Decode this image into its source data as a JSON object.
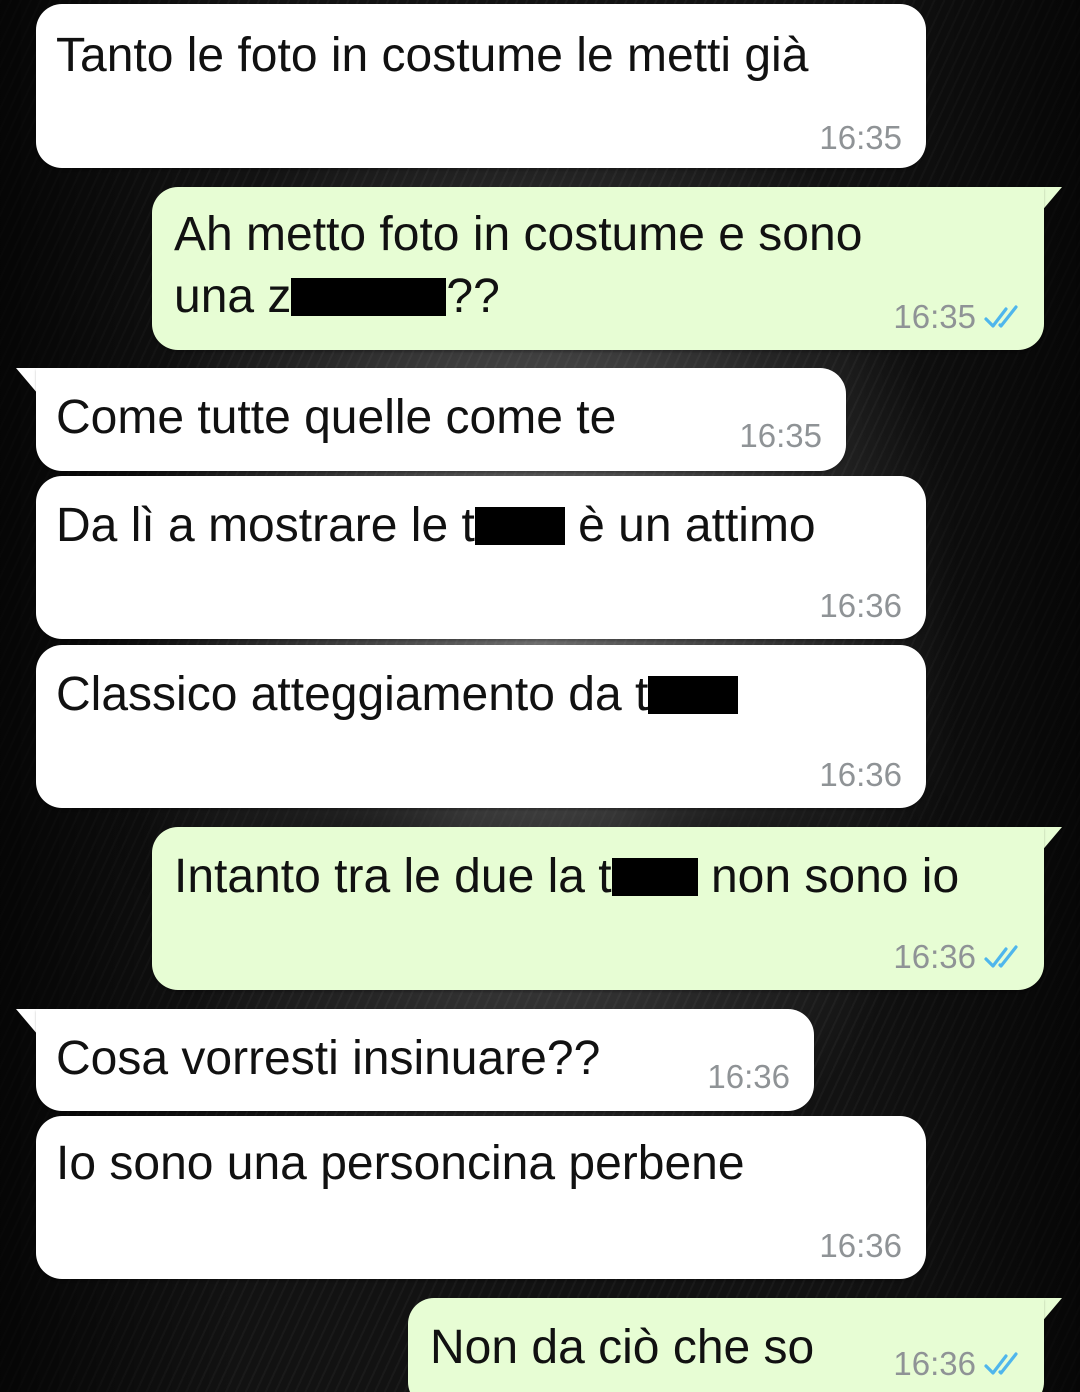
{
  "messages": [
    {
      "id": "m1",
      "direction": "incoming",
      "text": "Tanto le foto in costume le metti già",
      "time": "16:35"
    },
    {
      "id": "m2",
      "direction": "outgoing",
      "line1": "Ah metto foto in costume e sono",
      "line2_before": "una z",
      "line2_after": "??",
      "time": "16:35",
      "status": "read"
    },
    {
      "id": "m3",
      "direction": "incoming",
      "text": "Come tutte quelle come te",
      "time": "16:35"
    },
    {
      "id": "m4",
      "direction": "incoming",
      "text_before": "Da lì a mostrare le t",
      "text_after": " è un attimo",
      "time": "16:36"
    },
    {
      "id": "m5",
      "direction": "incoming",
      "text_before": "Classico atteggiamento da t",
      "text_after": "",
      "time": "16:36"
    },
    {
      "id": "m6",
      "direction": "outgoing",
      "text_before": "Intanto tra le due la t",
      "text_after": " non sono io",
      "time": "16:36",
      "status": "read"
    },
    {
      "id": "m7",
      "direction": "incoming",
      "text": "Cosa vorresti insinuare??",
      "time": "16:36"
    },
    {
      "id": "m8",
      "direction": "incoming",
      "text": "Io sono una personcina perbene",
      "time": "16:36"
    },
    {
      "id": "m9",
      "direction": "outgoing",
      "text": "Non da ciò che so",
      "time": "16:36",
      "status": "read"
    }
  ],
  "colors": {
    "incoming_bubble": "#ffffff",
    "outgoing_bubble": "#e7fdd4",
    "timestamp": "#8f9396",
    "read_ticks": "#4fb6ec",
    "redaction": "#000000"
  },
  "icons": {
    "read_status": "double-check-icon"
  }
}
